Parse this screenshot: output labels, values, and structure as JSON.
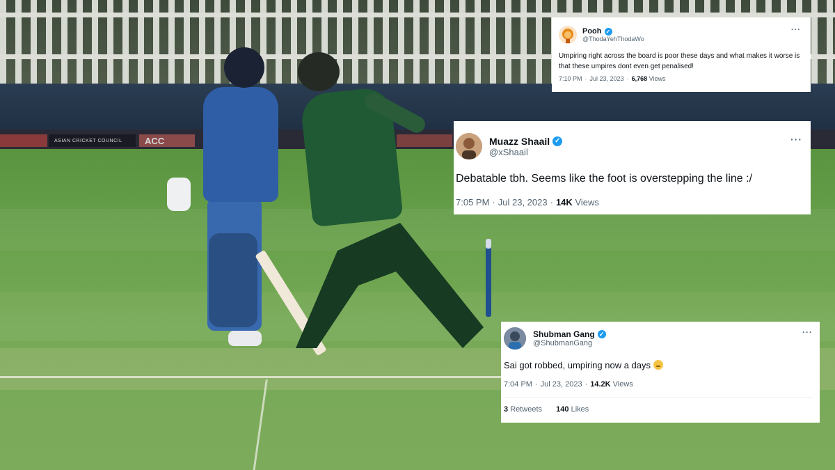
{
  "background": {
    "board_labels": [
      "",
      "ASIAN CRICKET COUNCIL",
      "ACC",
      ""
    ],
    "colors": {
      "grass": "#6aa24c",
      "fence": "#e3e5de",
      "tarp": "#2b3d52"
    }
  },
  "tweets": [
    {
      "avatar_icon": "lion-cartoon-avatar",
      "display_name": "Pooh",
      "handle": "@ThodaYehThodaWo",
      "verified": true,
      "text": "Umpiring right across the board is poor these days and what makes it worse is that these umpires dont even get penalised!",
      "time": "7:10 PM",
      "date": "Jul 23, 2023",
      "views_count": "6,768",
      "views_label": "Views"
    },
    {
      "avatar_icon": "user-photo-avatar",
      "display_name": "Muazz Shaail",
      "handle": "@xShaail",
      "verified": true,
      "text": "Debatable tbh. Seems like the foot is overstepping the line :/",
      "time": "7:05 PM",
      "date": "Jul 23, 2023",
      "views_count": "14K",
      "views_label": "Views"
    },
    {
      "avatar_icon": "user-photo-avatar",
      "display_name": "Shubman Gang",
      "handle": "@ShubmanGang",
      "verified": true,
      "text": "Sai got robbed, umpiring now a days",
      "emoji_icon": "disappointed-face-emoji",
      "time": "7:04 PM",
      "date": "Jul 23, 2023",
      "views_count": "14.2K",
      "views_label": "Views",
      "retweets_count": "3",
      "retweets_label": "Retweets",
      "likes_count": "140",
      "likes_label": "Likes"
    }
  ],
  "ui": {
    "separator": "·",
    "more_glyph": "···",
    "verified_glyph": "✓"
  }
}
